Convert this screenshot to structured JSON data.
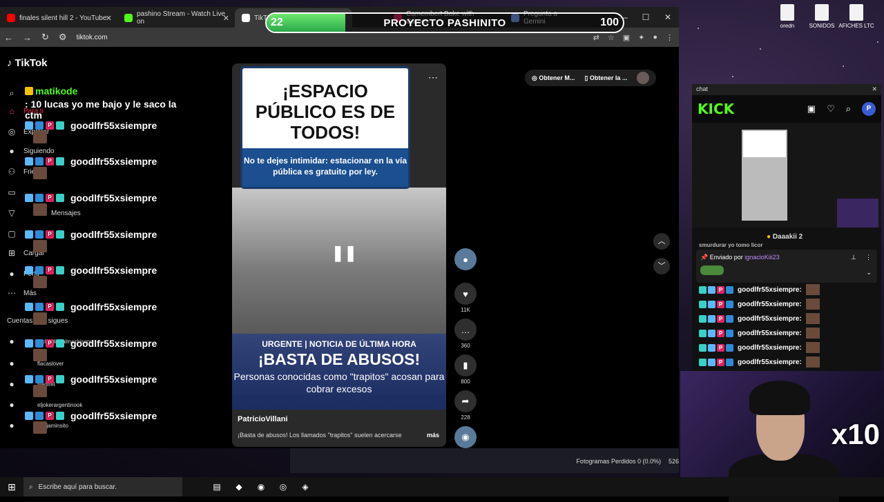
{
  "browser": {
    "tabs": [
      {
        "label": "finales silent hill 2 - YouTube",
        "color": "#ff0000"
      },
      {
        "label": "pashino Stream - Watch Live on",
        "color": "#53fc18"
      },
      {
        "label": "TikTok",
        "color": "#ffffff"
      },
      {
        "label": "Camembert Bake with Garnes",
        "color": "#e0245e"
      },
      {
        "label": "Pregunta a Gemini",
        "color": "#7aa7ff"
      }
    ],
    "url": "tiktok.com",
    "new_tab": "+"
  },
  "progress": {
    "min": "22",
    "max": "100",
    "title": "PROYECTO PASHINITO",
    "value": 22,
    "range": [
      0,
      100
    ]
  },
  "tiktok": {
    "logo": "TikTok",
    "sidebar": [
      {
        "label": "Para ti",
        "icon": "home-icon"
      },
      {
        "label": "Explorar",
        "icon": "compass-icon"
      },
      {
        "label": "Siguiendo",
        "icon": "following-icon"
      },
      {
        "label": "Friends",
        "icon": "friends-icon"
      },
      {
        "label": "LIVE",
        "icon": "live-icon"
      },
      {
        "label": "Mensajes",
        "icon": "messages-icon"
      },
      {
        "label": "Actividad",
        "icon": "activity-icon"
      },
      {
        "label": "Cargar",
        "icon": "upload-icon"
      },
      {
        "label": "Perfil",
        "icon": "profile-icon"
      },
      {
        "label": "Más",
        "icon": "more-icon"
      }
    ],
    "following_title": "Cuentas que sigues",
    "following": [
      "elclaudiopalmachiseno",
      "flacaslover",
      "Nadirel",
      "eljokerargentinook",
      "benjaminsito"
    ],
    "chat_first": {
      "user": "matikode",
      "text": ": 10 lucas yo me bajo y le saco la ctm"
    },
    "chat_repeat_user": "goodlfr55xsiempre",
    "video": {
      "sign_title": "¡ESPACIO PÚBLICO ES DE TODOS!",
      "sign_sub": "No te dejes intimidar: estacionar en la vía pública es gratuito por ley.",
      "news_l1": "URGENTE | NOTICIA DE ÚLTIMA HORA",
      "news_l2": "¡BASTA DE ABUSOS!",
      "news_l3": "Personas conocidas como \"trapitos\" acosan para cobrar excesos",
      "author": "PatricioVillani",
      "caption": "¡Basta de abusos! Los llamados \"trapitos\" suelen acercarse",
      "more": "más"
    },
    "actions": {
      "likes": "11K",
      "comments": "360",
      "saves": "800",
      "shares": "228"
    },
    "top_buttons": [
      "Obtener M...",
      "Obtener la ..."
    ]
  },
  "desktop_icons": [
    "oredn",
    "SONIDOS",
    "AFICHES LTC"
  ],
  "kick": {
    "window_title": "chat",
    "logo": "KICK",
    "viewer_label": "Daaakii",
    "viewer_count": "2",
    "pinned_by_label": "Enviado por",
    "pinned_user": "ignacioKiii23",
    "lines_user": "goodlfr55xsiempre:",
    "partial_line": "smurdurar yo tomo licor"
  },
  "webcam": {
    "overlay": "x10"
  },
  "obs": {
    "frames": "Fotogramas Perdidos 0 (0.0%)",
    "bitrate": "526"
  },
  "taskbar": {
    "search_placeholder": "Escribe aquí para buscar."
  }
}
